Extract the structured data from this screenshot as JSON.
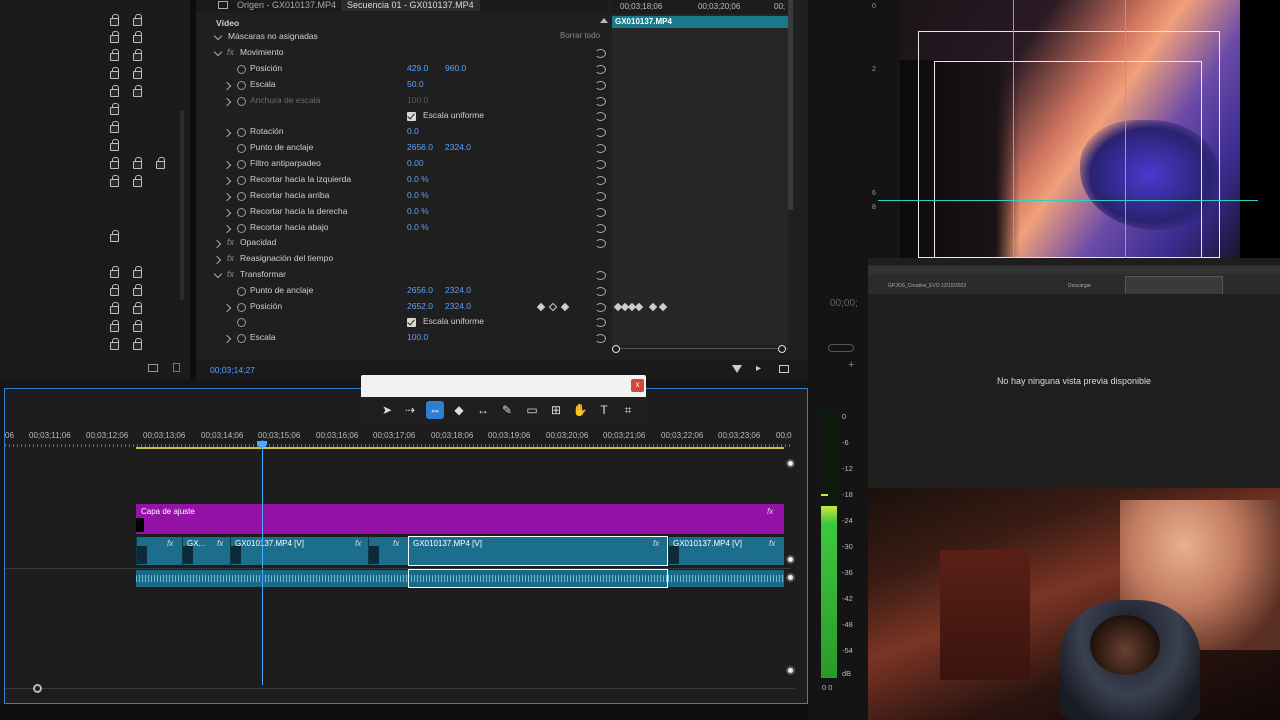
{
  "tabs": {
    "source": "Origen - GX010137.MP4",
    "sequence": "Secuencia 01 - GX010137.MP4"
  },
  "effect_controls": {
    "section_video": "Vídeo",
    "masks_label": "Máscaras no asignadas",
    "clear_all": "Borrar todo",
    "motion": "Movimiento",
    "position_label": "Posición",
    "position_x": "429.0",
    "position_y": "960.0",
    "scale_label": "Escala",
    "scale_value": "50.0",
    "scale_width_label": "Anchura de escala",
    "scale_width_value": "100.0",
    "uniform_scale": "Escala uniforme",
    "rotation_label": "Rotación",
    "rotation_value": "0.0",
    "anchor_label": "Punto de anclaje",
    "anchor_x": "2656.0",
    "anchor_y": "2324.0",
    "flicker_label": "Filtro antiparpadeo",
    "flicker_value": "0.00",
    "crop_left_label": "Recortar hacia la izquierda",
    "crop_left_value": "0.0 %",
    "crop_top_label": "Recortar hacia arriba",
    "crop_top_value": "0.0 %",
    "crop_right_label": "Recortar hacia la derecha",
    "crop_right_value": "0.0 %",
    "crop_bottom_label": "Recortar hacia abajo",
    "crop_bottom_value": "0.0 %",
    "opacity": "Opacidad",
    "time_remap": "Reasignación del tiempo",
    "transform": "Transformar",
    "t_anchor_label": "Punto de anclaje",
    "t_anchor_x": "2656.0",
    "t_anchor_y": "2324.0",
    "t_position_label": "Posición",
    "t_position_x": "2652.0",
    "t_position_y": "2324.0",
    "t_uniform_scale": "Escala uniforme",
    "t_scale_label": "Escala",
    "t_scale_value": "100.0",
    "timecode": "00;03;14;27",
    "mini_ruler_1": "00;03;18;06",
    "mini_ruler_2": "00;03;20;06",
    "mini_ruler_3": "00;",
    "mini_clip": "GX010137.MP4"
  },
  "timeline": {
    "ticks": [
      "06",
      "00;03;11;06",
      "00;03;12;06",
      "00;03;13;06",
      "00;03;14;06",
      "00;03;15;06",
      "00;03;16;06",
      "00;03;17;06",
      "00;03;18;06",
      "00;03;19;06",
      "00;03;20;06",
      "00;03;21;06",
      "00;03;22;06",
      "00;03;23;06",
      "00;0"
    ],
    "adjustment_layer": "Capa de ajuste",
    "clip_short": "GX...",
    "clip_a": "GX010137.MP4 [V]",
    "clip_b": "GX010137.MP4 [V]",
    "clip_c": "GX010137.MP4 [V]",
    "fx": "fx"
  },
  "program": {
    "timecode_partial": "00;00;"
  },
  "browser": {
    "no_preview": "No hay ninguna vista previa disponible",
    "download_label": "Descargar",
    "file_label": "GPJOS_Creative_EVO 12/15/2023"
  },
  "meter": {
    "labels": [
      "0",
      "-6",
      "-12",
      "-18",
      "-24",
      "-30",
      "-36",
      "-42",
      "-48",
      "-54",
      "dB"
    ],
    "bottom": "0 0"
  },
  "toolbar": {
    "close": "x"
  }
}
